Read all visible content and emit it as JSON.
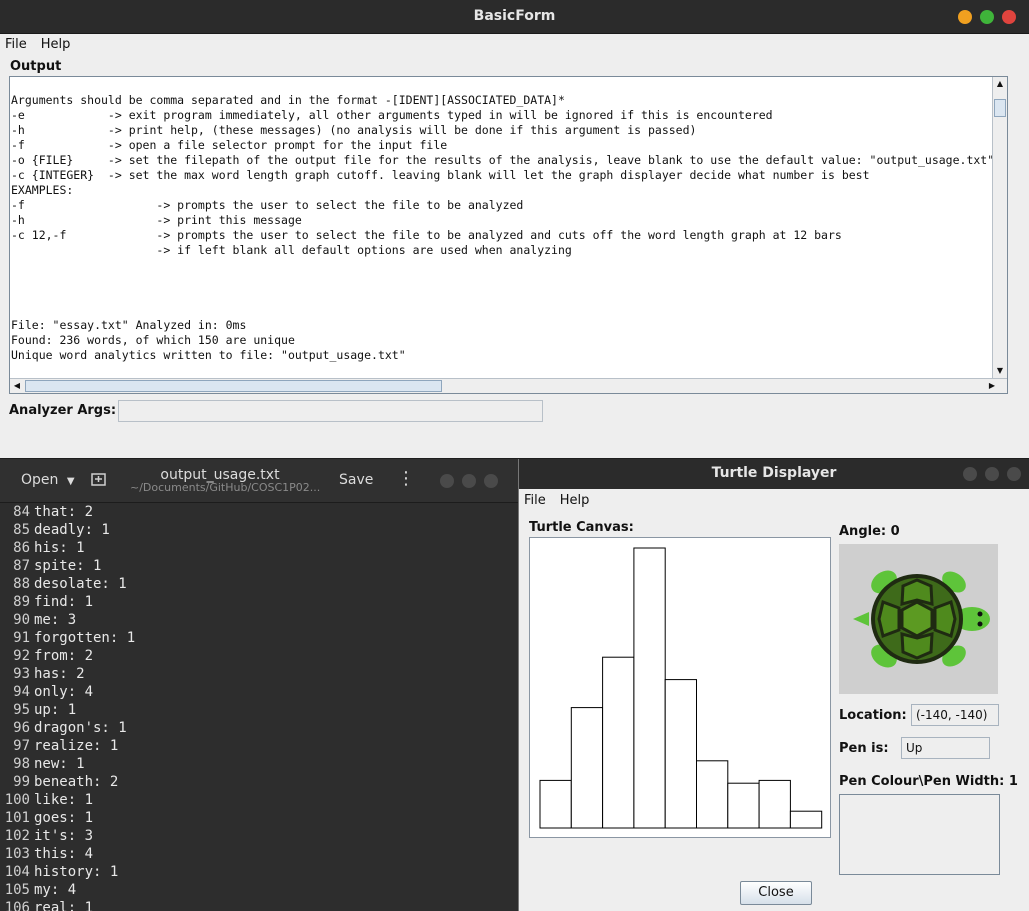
{
  "basic_form": {
    "title": "BasicForm",
    "menu": [
      "File",
      "Help"
    ],
    "output_label": "Output",
    "output_lines": [
      "Arguments should be comma separated and in the format -[IDENT][ASSOCIATED_DATA]*",
      "-e            -> exit program immediately, all other arguments typed in will be ignored if this is encountered",
      "-h            -> print help, (these messages) (no analysis will be done if this argument is passed)",
      "-f            -> open a file selector prompt for the input file",
      "-o {FILE}     -> set the filepath of the output file for the results of the analysis, leave blank to use the default value: \"output_usage.txt\"",
      "-c {INTEGER}  -> set the max word length graph cutoff. leaving blank will let the graph displayer decide what number is best",
      "EXAMPLES:",
      "-f                   -> prompts the user to select the file to be analyzed",
      "-h                   -> print this message",
      "-c 12,-f             -> prompts the user to select the file to be analyzed and cuts off the word length graph at 12 bars",
      "                     -> if left blank all default options are used when analyzing",
      "",
      "",
      "",
      "",
      "File: \"essay.txt\" Analyzed in: 0ms",
      "Found: 236 words, of which 150 are unique",
      "Unique word analytics written to file: \"output_usage.txt\""
    ],
    "args_label": "Analyzer Args:",
    "args_value": ""
  },
  "editor": {
    "open_label": "Open",
    "title": "output_usage.txt",
    "subtitle": "~/Documents/GitHub/COSC1P02...",
    "save_label": "Save",
    "lines": [
      {
        "num": "84",
        "text": "that: 2"
      },
      {
        "num": "85",
        "text": "deadly: 1"
      },
      {
        "num": "86",
        "text": "his: 1"
      },
      {
        "num": "87",
        "text": "spite: 1"
      },
      {
        "num": "88",
        "text": "desolate: 1"
      },
      {
        "num": "89",
        "text": "find: 1"
      },
      {
        "num": "90",
        "text": "me: 3"
      },
      {
        "num": "91",
        "text": "forgotten: 1"
      },
      {
        "num": "92",
        "text": "from: 2"
      },
      {
        "num": "93",
        "text": "has: 2"
      },
      {
        "num": "94",
        "text": "only: 4"
      },
      {
        "num": "95",
        "text": "up: 1"
      },
      {
        "num": "96",
        "text": "dragon's: 1"
      },
      {
        "num": "97",
        "text": "realize: 1"
      },
      {
        "num": "98",
        "text": "new: 1"
      },
      {
        "num": "99",
        "text": "beneath: 2"
      },
      {
        "num": "100",
        "text": "like: 1"
      },
      {
        "num": "101",
        "text": "goes: 1"
      },
      {
        "num": "102",
        "text": "it's: 3"
      },
      {
        "num": "103",
        "text": "this: 4"
      },
      {
        "num": "104",
        "text": "history: 1"
      },
      {
        "num": "105",
        "text": "my: 4"
      },
      {
        "num": "106",
        "text": "real: 1"
      }
    ]
  },
  "turtle": {
    "title": "Turtle Displayer",
    "menu": [
      "File",
      "Help"
    ],
    "canvas_label": "Turtle Canvas:",
    "angle_label": "Angle: 0",
    "location_label": "Location:",
    "location_value": "(-140, -140)",
    "pen_label": "Pen is:",
    "pen_value": "Up",
    "pen_colour_label": "Pen Colour\\Pen Width: 1",
    "close_label": "Close",
    "bars": [
      0.17,
      0.43,
      0.61,
      1.0,
      0.53,
      0.24,
      0.16,
      0.17,
      0.06
    ]
  },
  "colors": {
    "title_close": "#e0443e",
    "title_max": "#3fb43a",
    "title_min": "#f0a020"
  }
}
